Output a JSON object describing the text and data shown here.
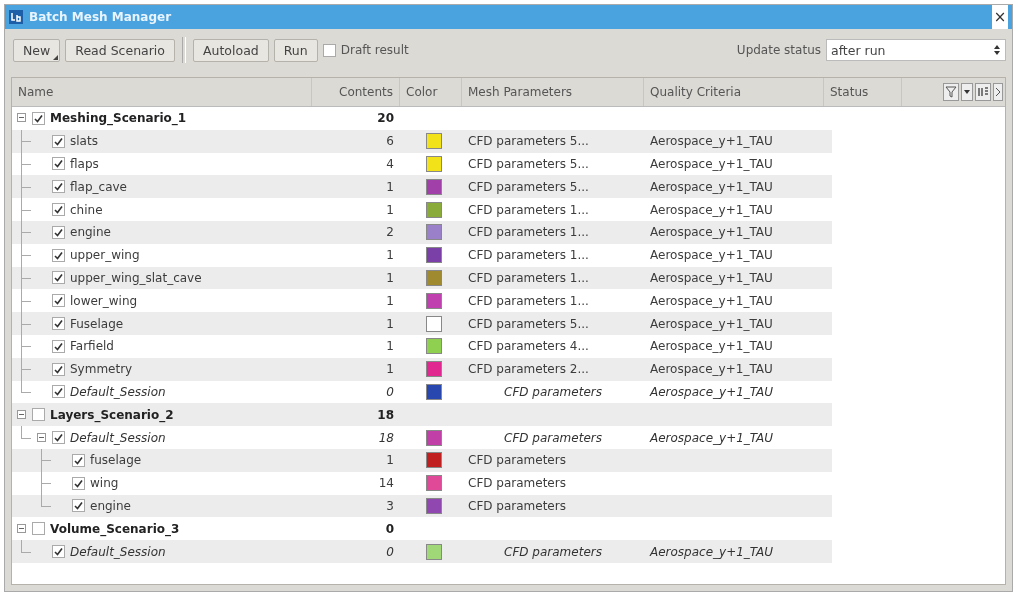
{
  "window": {
    "title": "Batch Mesh Manager",
    "close": "×"
  },
  "toolbar": {
    "buttons": [
      {
        "label": "New",
        "kind": "menu"
      },
      {
        "label": "Read Scenario",
        "kind": "plain"
      },
      {
        "label": "Autoload",
        "kind": "plain",
        "group_start": true
      },
      {
        "label": "Run",
        "kind": "plain"
      }
    ],
    "draft": {
      "label": "Draft result",
      "checked": false
    },
    "update_status": {
      "label": "Update status",
      "value": "after run"
    }
  },
  "table": {
    "columns": [
      "Name",
      "Contents",
      "Color",
      "Mesh Parameters",
      "Quality Criteria",
      "Status"
    ],
    "rows": [
      {
        "kind": "scenario",
        "name": "Meshing_Scenario_1",
        "checked": true,
        "expanded": true,
        "contents": "20",
        "children": [
          {
            "kind": "part",
            "name": "slats",
            "checked": true,
            "contents": "6",
            "color": "#f2e21a",
            "mesh": "CFD parameters 5...",
            "quality": "Aerospace_y+1_TAU"
          },
          {
            "kind": "part",
            "name": "flaps",
            "checked": true,
            "contents": "4",
            "color": "#f2e21a",
            "mesh": "CFD parameters 5...",
            "quality": "Aerospace_y+1_TAU"
          },
          {
            "kind": "part",
            "name": "flap_cave",
            "checked": true,
            "contents": "1",
            "color": "#a040a8",
            "mesh": "CFD parameters 5...",
            "quality": "Aerospace_y+1_TAU"
          },
          {
            "kind": "part",
            "name": "chine",
            "checked": true,
            "contents": "1",
            "color": "#8aab3a",
            "mesh": "CFD parameters 1...",
            "quality": "Aerospace_y+1_TAU"
          },
          {
            "kind": "part",
            "name": "engine",
            "checked": true,
            "contents": "2",
            "color": "#9a80c8",
            "mesh": "CFD parameters 1...",
            "quality": "Aerospace_y+1_TAU"
          },
          {
            "kind": "part",
            "name": "upper_wing",
            "checked": true,
            "contents": "1",
            "color": "#7a40a8",
            "mesh": "CFD parameters 1...",
            "quality": "Aerospace_y+1_TAU"
          },
          {
            "kind": "part",
            "name": "upper_wing_slat_cave",
            "checked": true,
            "contents": "1",
            "color": "#a08a30",
            "mesh": "CFD parameters 1...",
            "quality": "Aerospace_y+1_TAU"
          },
          {
            "kind": "part",
            "name": "lower_wing",
            "checked": true,
            "contents": "1",
            "color": "#c040b0",
            "mesh": "CFD parameters 1...",
            "quality": "Aerospace_y+1_TAU"
          },
          {
            "kind": "part",
            "name": "Fuselage",
            "checked": true,
            "contents": "1",
            "color": "#ffffff",
            "mesh": "CFD parameters 5...",
            "quality": "Aerospace_y+1_TAU"
          },
          {
            "kind": "part",
            "name": "Farfield",
            "checked": true,
            "contents": "1",
            "color": "#90d050",
            "mesh": "CFD parameters 4...",
            "quality": "Aerospace_y+1_TAU"
          },
          {
            "kind": "part",
            "name": "Symmetry",
            "checked": true,
            "contents": "1",
            "color": "#e02890",
            "mesh": "CFD parameters 2...",
            "quality": "Aerospace_y+1_TAU"
          },
          {
            "kind": "session",
            "name": "Default_Session",
            "checked": true,
            "contents": "0",
            "color": "#2848b0",
            "mesh": "CFD parameters",
            "quality": "Aerospace_y+1_TAU"
          }
        ]
      },
      {
        "kind": "scenario",
        "name": "Layers_Scenario_2",
        "checked": false,
        "expanded": true,
        "contents": "18",
        "children": [
          {
            "kind": "session",
            "name": "Default_Session",
            "checked": true,
            "expanded": true,
            "contents": "18",
            "color": "#c040a8",
            "mesh": "CFD parameters",
            "quality": "Aerospace_y+1_TAU",
            "children": [
              {
                "kind": "part",
                "name": "fuselage",
                "checked": true,
                "contents": "1",
                "color": "#c02020",
                "mesh": "CFD parameters"
              },
              {
                "kind": "part",
                "name": "wing",
                "checked": true,
                "contents": "14",
                "color": "#e04898",
                "mesh": "CFD parameters"
              },
              {
                "kind": "part",
                "name": "engine",
                "checked": true,
                "contents": "3",
                "color": "#9048b0",
                "mesh": "CFD parameters"
              }
            ]
          }
        ]
      },
      {
        "kind": "scenario",
        "name": "Volume_Scenario_3",
        "checked": false,
        "expanded": true,
        "contents": "0",
        "children": [
          {
            "kind": "session",
            "name": "Default_Session",
            "checked": true,
            "contents": "0",
            "color": "#a0d878",
            "mesh": "CFD parameters",
            "quality": "Aerospace_y+1_TAU"
          }
        ]
      }
    ]
  }
}
